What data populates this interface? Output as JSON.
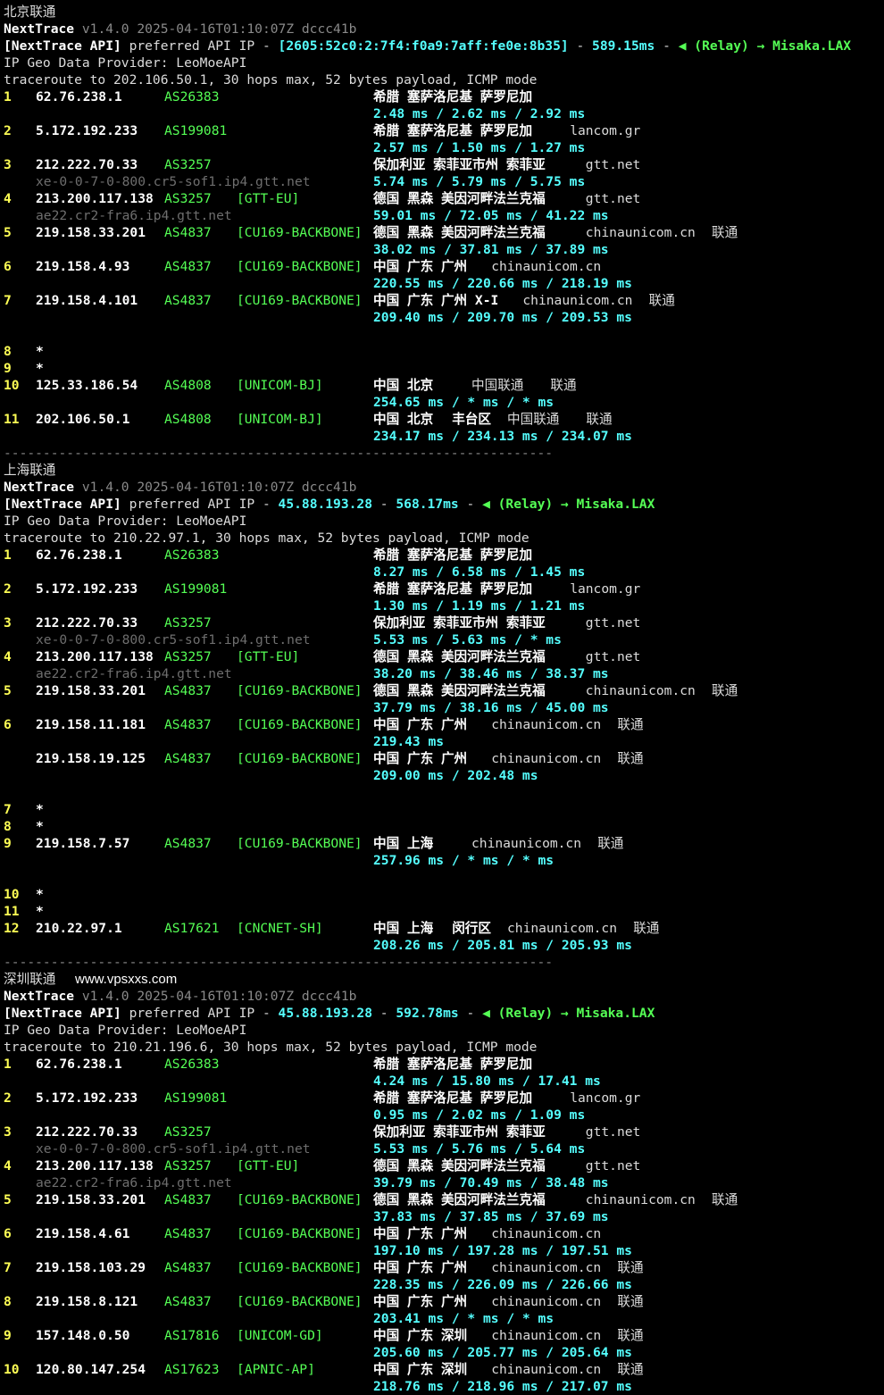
{
  "watermark": "www.vpsxxs.com",
  "sections": [
    {
      "title": "北京联通",
      "header": {
        "app": "NextTrace",
        "version": "v1.4.0 2025-04-16T01:10:07Z dccc41b",
        "api_prefix": "[NextTrace API]",
        "api_text": "preferred API IP -",
        "api_ip": "[2605:52c0:2:7f4:f0a9:7aff:fe0e:8b35]",
        "api_dash": "-",
        "api_ms": "589.15ms",
        "api_dash2": "-",
        "relay": "◀ (Relay) → Misaka.LAX",
        "geo_provider": "IP Geo Data Provider: LeoMoeAPI",
        "traceroute": "traceroute to 202.106.50.1, 30 hops max, 52 bytes payload, ICMP mode"
      },
      "lines": [
        {
          "hop": "1",
          "ip": "62.76.238.1",
          "as": "AS26383",
          "tag": "",
          "geo": "希腊 塞萨洛尼基 萨罗尼加",
          "dom": "",
          "isp": ""
        },
        {
          "rtt": "2.48 ms / 2.62 ms / 2.92 ms"
        },
        {
          "hop": "2",
          "ip": "5.172.192.233",
          "as": "AS199081",
          "tag": "",
          "geo": "希腊 塞萨洛尼基 萨罗尼加",
          "dom": "lancom.gr",
          "isp": ""
        },
        {
          "rtt": "2.57 ms / 1.50 ms / 1.27 ms"
        },
        {
          "hop": "3",
          "ip": "212.222.70.33",
          "as": "AS3257",
          "tag": "",
          "geo": "保加利亚 索菲亚市州 索菲亚",
          "dom": "gtt.net",
          "isp": ""
        },
        {
          "rdns": "xe-0-0-7-0-800.cr5-sof1.ip4.gtt.net",
          "rtt": "5.74 ms / 5.79 ms / 5.75 ms"
        },
        {
          "hop": "4",
          "ip": "213.200.117.138",
          "as": "AS3257",
          "tag": "[GTT-EU]",
          "geo": "德国 黑森 美因河畔法兰克福",
          "dom": "gtt.net",
          "isp": ""
        },
        {
          "rdns": "ae22.cr2-fra6.ip4.gtt.net",
          "rtt": "59.01 ms / 72.05 ms / 41.22 ms"
        },
        {
          "hop": "5",
          "ip": "219.158.33.201",
          "as": "AS4837",
          "tag": "[CU169-BACKBONE]",
          "geo": "德国 黑森 美因河畔法兰克福",
          "dom": "chinaunicom.cn",
          "isp": "联通"
        },
        {
          "rtt": "38.02 ms / 37.81 ms / 37.89 ms"
        },
        {
          "hop": "6",
          "ip": "219.158.4.93",
          "as": "AS4837",
          "tag": "[CU169-BACKBONE]",
          "geo": "中国 广东 广州",
          "dom": "chinaunicom.cn",
          "isp": ""
        },
        {
          "rtt": "220.55 ms / 220.66 ms / 218.19 ms"
        },
        {
          "hop": "7",
          "ip": "219.158.4.101",
          "as": "AS4837",
          "tag": "[CU169-BACKBONE]",
          "geo": "中国 广东 广州 X-I",
          "dom": "chinaunicom.cn",
          "isp": "联通"
        },
        {
          "rtt": "209.40 ms / 209.70 ms / 209.53 ms"
        },
        {},
        {
          "hop": "8",
          "ip": "*"
        },
        {
          "hop": "9",
          "ip": "*"
        },
        {
          "hop": "10",
          "ip": "125.33.186.54",
          "as": "AS4808",
          "tag": "[UNICOM-BJ]",
          "geo": "中国 北京",
          "dom": "中国联通",
          "isp": "联通",
          "domcol": "528"
        },
        {
          "rtt": "254.65 ms / * ms / * ms"
        },
        {
          "hop": "11",
          "ip": "202.106.50.1",
          "as": "AS4808",
          "tag": "[UNICOM-BJ]",
          "geo": "中国 北京",
          "geo2": "丰台区",
          "dom": "中国联通",
          "isp": "联通"
        },
        {
          "rtt": "234.17 ms / 234.13 ms / 234.07 ms"
        }
      ]
    },
    {
      "title": "上海联通",
      "header": {
        "app": "NextTrace",
        "version": "v1.4.0 2025-04-16T01:10:07Z dccc41b",
        "api_prefix": "[NextTrace API]",
        "api_text": "preferred API IP -",
        "api_ip": "45.88.193.28",
        "api_dash": "-",
        "api_ms": "568.17ms",
        "api_dash2": "-",
        "relay": "◀ (Relay) → Misaka.LAX",
        "geo_provider": "IP Geo Data Provider: LeoMoeAPI",
        "traceroute": "traceroute to 210.22.97.1, 30 hops max, 52 bytes payload, ICMP mode"
      },
      "lines": [
        {
          "hop": "1",
          "ip": "62.76.238.1",
          "as": "AS26383",
          "tag": "",
          "geo": "希腊 塞萨洛尼基 萨罗尼加",
          "dom": "",
          "isp": ""
        },
        {
          "rtt": "8.27 ms / 6.58 ms / 1.45 ms"
        },
        {
          "hop": "2",
          "ip": "5.172.192.233",
          "as": "AS199081",
          "tag": "",
          "geo": "希腊 塞萨洛尼基 萨罗尼加",
          "dom": "lancom.gr",
          "isp": ""
        },
        {
          "rtt": "1.30 ms / 1.19 ms / 1.21 ms"
        },
        {
          "hop": "3",
          "ip": "212.222.70.33",
          "as": "AS3257",
          "tag": "",
          "geo": "保加利亚 索菲亚市州 索菲亚",
          "dom": "gtt.net",
          "isp": ""
        },
        {
          "rdns": "xe-0-0-7-0-800.cr5-sof1.ip4.gtt.net",
          "rtt": "5.53 ms / 5.63 ms / * ms"
        },
        {
          "hop": "4",
          "ip": "213.200.117.138",
          "as": "AS3257",
          "tag": "[GTT-EU]",
          "geo": "德国 黑森 美因河畔法兰克福",
          "dom": "gtt.net",
          "isp": ""
        },
        {
          "rdns": "ae22.cr2-fra6.ip4.gtt.net",
          "rtt": "38.20 ms / 38.46 ms / 38.37 ms"
        },
        {
          "hop": "5",
          "ip": "219.158.33.201",
          "as": "AS4837",
          "tag": "[CU169-BACKBONE]",
          "geo": "德国 黑森 美因河畔法兰克福",
          "dom": "chinaunicom.cn",
          "isp": "联通"
        },
        {
          "rtt": "37.79 ms / 38.16 ms / 45.00 ms"
        },
        {
          "hop": "6",
          "ip": "219.158.11.181",
          "as": "AS4837",
          "tag": "[CU169-BACKBONE]",
          "geo": "中国 广东 广州",
          "dom": "chinaunicom.cn",
          "isp": "联通"
        },
        {
          "rtt": "219.43 ms"
        },
        {
          "hop": "",
          "ip": "219.158.19.125",
          "as": "AS4837",
          "tag": "[CU169-BACKBONE]",
          "geo": "中国 广东 广州",
          "dom": "chinaunicom.cn",
          "isp": "联通"
        },
        {
          "rtt": "209.00 ms / 202.48 ms"
        },
        {},
        {
          "hop": "7",
          "ip": "*"
        },
        {
          "hop": "8",
          "ip": "*"
        },
        {
          "hop": "9",
          "ip": "219.158.7.57",
          "as": "AS4837",
          "tag": "[CU169-BACKBONE]",
          "geo": "中国 上海",
          "dom": "chinaunicom.cn",
          "isp": "联通",
          "domcol": "528"
        },
        {
          "rtt": "257.96 ms / * ms / * ms"
        },
        {},
        {
          "hop": "10",
          "ip": "*"
        },
        {
          "hop": "11",
          "ip": "*"
        },
        {
          "hop": "12",
          "ip": "210.22.97.1",
          "as": "AS17621",
          "tag": "[CNCNET-SH]",
          "geo": "中国 上海",
          "geo2": "闵行区",
          "dom": "chinaunicom.cn",
          "isp": "联通"
        },
        {
          "rtt": "208.26 ms / 205.81 ms / 205.93 ms"
        }
      ]
    },
    {
      "title": "深圳联通",
      "header": {
        "app": "NextTrace",
        "version": "v1.4.0 2025-04-16T01:10:07Z dccc41b",
        "api_prefix": "[NextTrace API]",
        "api_text": "preferred API IP -",
        "api_ip": "45.88.193.28",
        "api_dash": "-",
        "api_ms": "592.78ms",
        "api_dash2": "-",
        "relay": "◀ (Relay) → Misaka.LAX",
        "geo_provider": "IP Geo Data Provider: LeoMoeAPI",
        "traceroute": "traceroute to 210.21.196.6, 30 hops max, 52 bytes payload, ICMP mode"
      },
      "lines": [
        {
          "hop": "1",
          "ip": "62.76.238.1",
          "as": "AS26383",
          "tag": "",
          "geo": "希腊 塞萨洛尼基 萨罗尼加",
          "dom": "",
          "isp": ""
        },
        {
          "rtt": "4.24 ms / 15.80 ms / 17.41 ms"
        },
        {
          "hop": "2",
          "ip": "5.172.192.233",
          "as": "AS199081",
          "tag": "",
          "geo": "希腊 塞萨洛尼基 萨罗尼加",
          "dom": "lancom.gr",
          "isp": ""
        },
        {
          "rtt": "0.95 ms / 2.02 ms / 1.09 ms"
        },
        {
          "hop": "3",
          "ip": "212.222.70.33",
          "as": "AS3257",
          "tag": "",
          "geo": "保加利亚 索菲亚市州 索菲亚",
          "dom": "gtt.net",
          "isp": ""
        },
        {
          "rdns": "xe-0-0-7-0-800.cr5-sof1.ip4.gtt.net",
          "rtt": "5.53 ms / 5.76 ms / 5.64 ms"
        },
        {
          "hop": "4",
          "ip": "213.200.117.138",
          "as": "AS3257",
          "tag": "[GTT-EU]",
          "geo": "德国 黑森 美因河畔法兰克福",
          "dom": "gtt.net",
          "isp": ""
        },
        {
          "rdns": "ae22.cr2-fra6.ip4.gtt.net",
          "rtt": "39.79 ms / 70.49 ms / 38.48 ms"
        },
        {
          "hop": "5",
          "ip": "219.158.33.201",
          "as": "AS4837",
          "tag": "[CU169-BACKBONE]",
          "geo": "德国 黑森 美因河畔法兰克福",
          "dom": "chinaunicom.cn",
          "isp": "联通"
        },
        {
          "rtt": "37.83 ms / 37.85 ms / 37.69 ms"
        },
        {
          "hop": "6",
          "ip": "219.158.4.61",
          "as": "AS4837",
          "tag": "[CU169-BACKBONE]",
          "geo": "中国 广东 广州",
          "dom": "chinaunicom.cn",
          "isp": ""
        },
        {
          "rtt": "197.10 ms / 197.28 ms / 197.51 ms"
        },
        {
          "hop": "7",
          "ip": "219.158.103.29",
          "as": "AS4837",
          "tag": "[CU169-BACKBONE]",
          "geo": "中国 广东 广州",
          "dom": "chinaunicom.cn",
          "isp": "联通"
        },
        {
          "rtt": "228.35 ms / 226.09 ms / 226.66 ms"
        },
        {
          "hop": "8",
          "ip": "219.158.8.121",
          "as": "AS4837",
          "tag": "[CU169-BACKBONE]",
          "geo": "中国 广东 广州",
          "dom": "chinaunicom.cn",
          "isp": "联通"
        },
        {
          "rtt": "203.41 ms / * ms / * ms"
        },
        {
          "hop": "9",
          "ip": "157.148.0.50",
          "as": "AS17816",
          "tag": "[UNICOM-GD]",
          "geo": "中国 广东 深圳",
          "dom": "chinaunicom.cn",
          "isp": "联通"
        },
        {
          "rtt": "205.60 ms / 205.77 ms / 205.64 ms"
        },
        {
          "hop": "10",
          "ip": "120.80.147.254",
          "as": "AS17623",
          "tag": "[APNIC-AP]",
          "geo": "中国 广东 深圳",
          "dom": "chinaunicom.cn",
          "isp": "联通"
        },
        {
          "rtt": "218.76 ms / 218.96 ms / 217.07 ms"
        }
      ]
    }
  ],
  "separator": "----------------------------------------------------------------------"
}
